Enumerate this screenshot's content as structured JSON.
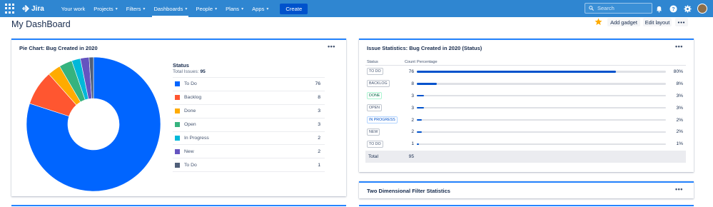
{
  "nav": {
    "logo_text": "Jira",
    "items": [
      {
        "label": "Your work",
        "has_menu": false
      },
      {
        "label": "Projects",
        "has_menu": true
      },
      {
        "label": "Filters",
        "has_menu": true
      },
      {
        "label": "Dashboards",
        "has_menu": true,
        "active": true
      },
      {
        "label": "People",
        "has_menu": true
      },
      {
        "label": "Plans",
        "has_menu": true
      },
      {
        "label": "Apps",
        "has_menu": true
      }
    ],
    "create_label": "Create",
    "search_placeholder": "Search",
    "icons": [
      "notification-icon",
      "help-icon",
      "settings-icon",
      "avatar"
    ]
  },
  "header": {
    "title": "My DashBoard",
    "add_gadget_label": "Add gadget",
    "edit_layout_label": "Edit layout",
    "more_label": "•••"
  },
  "pie_gadget": {
    "title": "Pie Chart: Bug Created in 2020",
    "more_label": "•••",
    "legend_title": "Status",
    "total_label": "Total Issues:",
    "total_value": "95"
  },
  "stats_gadget": {
    "title": "Issue Statistics: Bug Created in 2020 (Status)",
    "more_label": "•••",
    "columns": {
      "status": "Status",
      "count": "Count",
      "percentage": "Percentage"
    },
    "rows": [
      {
        "status": "TO DO",
        "count": "76",
        "percent": 80,
        "percent_label": "80%",
        "lozenge": "default"
      },
      {
        "status": "BACKLOG",
        "count": "8",
        "percent": 8,
        "percent_label": "8%",
        "lozenge": "default"
      },
      {
        "status": "DONE",
        "count": "3",
        "percent": 3,
        "percent_label": "3%",
        "lozenge": "green"
      },
      {
        "status": "OPEN",
        "count": "3",
        "percent": 3,
        "percent_label": "3%",
        "lozenge": "default"
      },
      {
        "status": "IN PROGRESS",
        "count": "2",
        "percent": 2,
        "percent_label": "2%",
        "lozenge": "blue"
      },
      {
        "status": "NEW",
        "count": "2",
        "percent": 2,
        "percent_label": "2%",
        "lozenge": "default"
      },
      {
        "status": "TO DO",
        "count": "1",
        "percent": 1,
        "percent_label": "1%",
        "lozenge": "default"
      }
    ],
    "total_label": "Total",
    "total_value": "95"
  },
  "twod_gadget": {
    "title": "Two Dimensional Filter Statistics",
    "more_label": "•••"
  },
  "colors": {
    "nav_bg": "#2f86d1",
    "accent": "#2684ff",
    "bar": "#0052cc"
  },
  "chart_data": {
    "type": "pie",
    "style": "donut",
    "title": "Pie Chart: Bug Created in 2020",
    "legend_title": "Status",
    "total": 95,
    "categories": [
      "To Do",
      "Backlog",
      "Done",
      "Open",
      "In Progress",
      "New",
      "To Do"
    ],
    "values": [
      76,
      8,
      3,
      3,
      2,
      2,
      1
    ],
    "colors": [
      "#0065ff",
      "#ff5630",
      "#ffab00",
      "#36b37e",
      "#00b8d9",
      "#6554c0",
      "#505f79"
    ],
    "legend_placement": "right"
  }
}
